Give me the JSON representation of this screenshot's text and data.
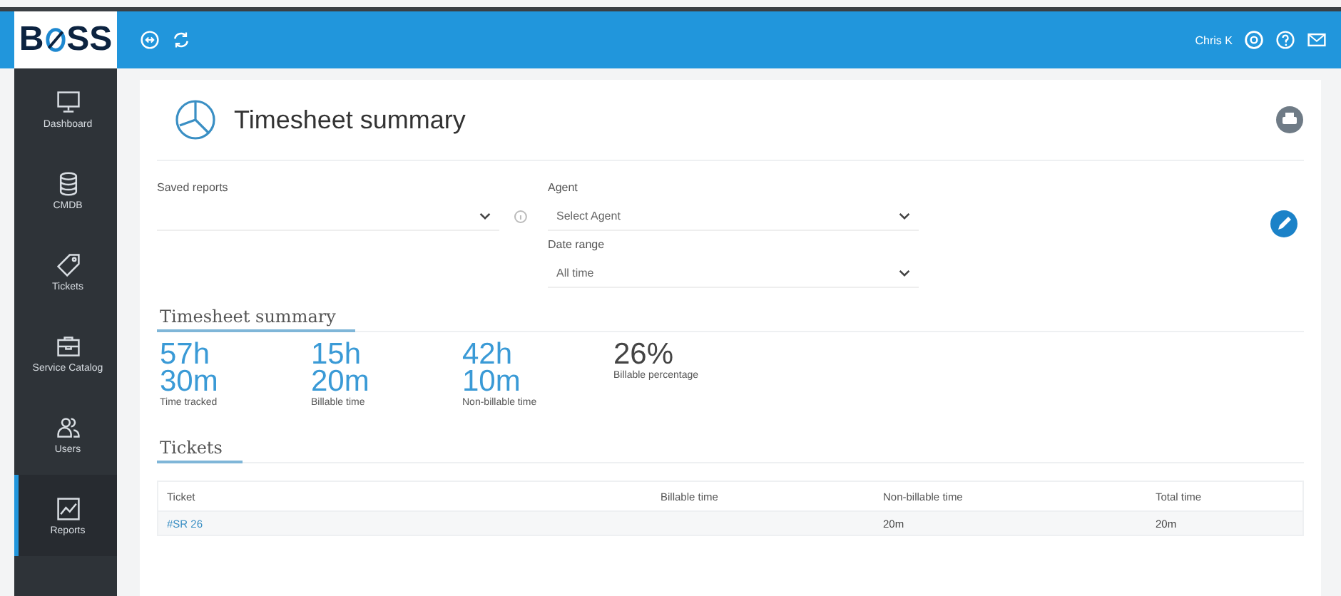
{
  "app": {
    "logo": "B",
    "logo_rest": "SS",
    "user": "Chris K"
  },
  "sidebar": {
    "items": [
      {
        "label": "Dashboard",
        "kind": "monitor",
        "selected": false
      },
      {
        "label": "CMDB",
        "kind": "database",
        "selected": false
      },
      {
        "label": "Tickets",
        "kind": "tag",
        "selected": false
      },
      {
        "label": "Service Catalog",
        "kind": "briefcase",
        "selected": false
      },
      {
        "label": "Users",
        "kind": "users",
        "selected": false
      },
      {
        "label": "Reports",
        "kind": "chart",
        "selected": true
      }
    ]
  },
  "page": {
    "title": "Timesheet summary"
  },
  "filters": {
    "saved_reports": {
      "label": "Saved reports"
    },
    "agent": {
      "label": "Agent",
      "value": "Select Agent"
    },
    "date_range": {
      "label": "Date range",
      "value": "All time"
    }
  },
  "summary": {
    "heading": "Timesheet summary",
    "stats": [
      {
        "hours": "57h",
        "minutes": "30m",
        "label": "Time tracked"
      },
      {
        "hours": "15h",
        "minutes": "20m",
        "label": "Billable time"
      },
      {
        "hours": "42h",
        "minutes": "10m",
        "label": "Non-billable time"
      }
    ],
    "percentage": {
      "value": "26%",
      "label": "Billable percentage"
    }
  },
  "tickets": {
    "heading": "Tickets",
    "columns": [
      "Ticket",
      "Billable time",
      "Non-billable time",
      "Total time"
    ],
    "rows": [
      [
        "#SR 26",
        "",
        "20m",
        "20m"
      ]
    ]
  }
}
